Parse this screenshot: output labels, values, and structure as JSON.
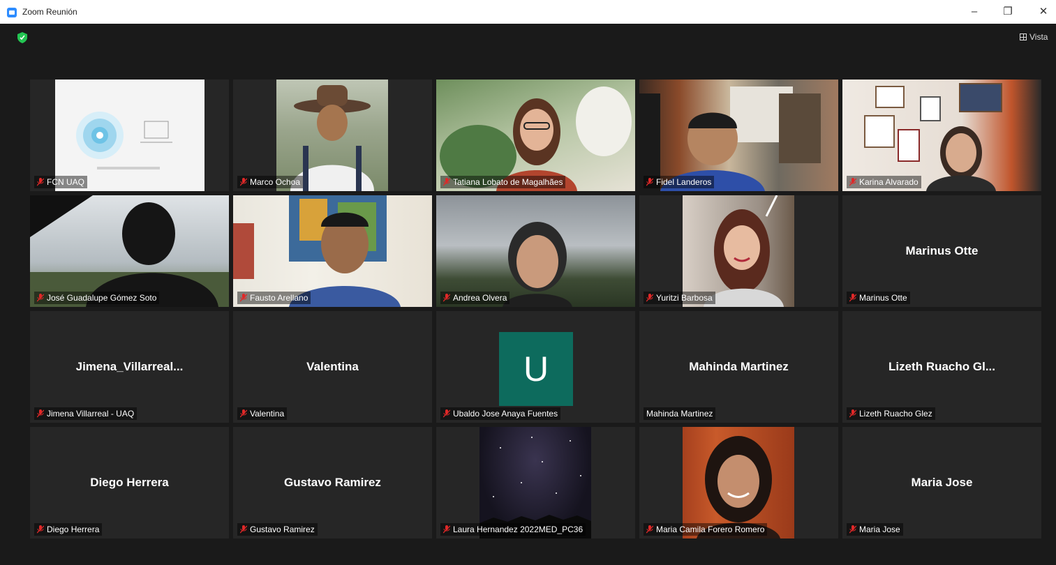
{
  "window": {
    "title": "Zoom Reunión",
    "min": "–",
    "max": "❐",
    "close": "✕"
  },
  "header": {
    "view_label": "Vista"
  },
  "colors": {
    "active_border": "#c3e05b",
    "mic_red": "#e02828",
    "avatar_u": "#0d6b5d"
  },
  "tiles": [
    {
      "name": "FCN UAQ",
      "big_name": ""
    },
    {
      "name": "Marco Ochoa",
      "big_name": ""
    },
    {
      "name": "Tatiana Lobato de Magalhães",
      "big_name": ""
    },
    {
      "name": "Fidel Landeros",
      "big_name": ""
    },
    {
      "name": "Karina Alvarado",
      "big_name": ""
    },
    {
      "name": "José Guadalupe Gómez Soto",
      "big_name": ""
    },
    {
      "name": "Fausto Arellano",
      "big_name": ""
    },
    {
      "name": "Andrea Olvera",
      "big_name": ""
    },
    {
      "name": "Yuritzi Barbosa",
      "big_name": ""
    },
    {
      "name": "Marinus Otte",
      "big_name": "Marinus Otte"
    },
    {
      "name": "Jimena Villarreal - UAQ",
      "big_name": "Jimena_Villarreal..."
    },
    {
      "name": "Valentina",
      "big_name": "Valentina"
    },
    {
      "name": "Ubaldo Jose Anaya Fuentes",
      "big_name": "",
      "avatar": "U"
    },
    {
      "name": "Mahinda Martinez",
      "big_name": "Mahinda Martinez"
    },
    {
      "name": "Lizeth Ruacho Glez",
      "big_name": "Lizeth Ruacho Gl..."
    },
    {
      "name": "Diego Herrera",
      "big_name": "Diego Herrera"
    },
    {
      "name": "Gustavo Ramirez",
      "big_name": "Gustavo Ramirez"
    },
    {
      "name": "Laura Hernandez 2022MED_PC36",
      "big_name": ""
    },
    {
      "name": "Maria Camila Forero Romero",
      "big_name": ""
    },
    {
      "name": "Maria Jose",
      "big_name": "Maria Jose"
    }
  ]
}
